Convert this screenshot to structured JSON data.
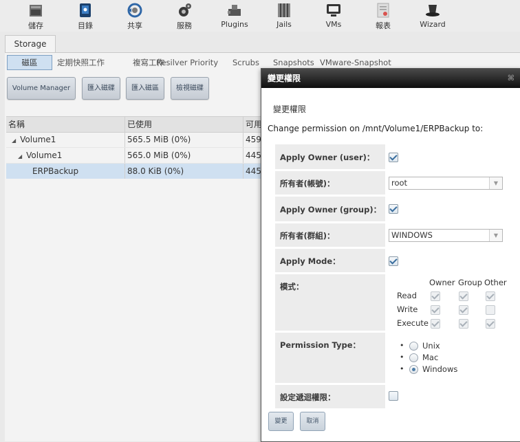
{
  "toolbar": [
    {
      "label": "儲存",
      "icon": "storage-icon"
    },
    {
      "label": "目錄",
      "icon": "directory-icon"
    },
    {
      "label": "共享",
      "icon": "sharing-icon"
    },
    {
      "label": "服務",
      "icon": "services-icon"
    },
    {
      "label": "Plugins",
      "icon": "plugins-icon"
    },
    {
      "label": "Jails",
      "icon": "jails-icon"
    },
    {
      "label": "VMs",
      "icon": "vms-icon"
    },
    {
      "label": "報表",
      "icon": "reporting-icon"
    },
    {
      "label": "Wizard",
      "icon": "wizard-icon"
    }
  ],
  "main": {
    "tab": "Storage",
    "subtabs": [
      "磁區",
      "定期快照工作",
      "複寫工作",
      "Resilver Priority",
      "Scrubs",
      "Snapshots",
      "VMware-Snapshot"
    ],
    "actions": [
      "Volume Manager",
      "匯入磁碟",
      "匯入磁區",
      "檢視磁碟"
    ],
    "table": {
      "headers": [
        "名稱",
        "已使用",
        "可用"
      ],
      "rows": [
        {
          "name": "Volume1",
          "used": "565.5 MiB (0%)",
          "avail": "459"
        },
        {
          "name": "Volume1",
          "used": "565.0 MiB (0%)",
          "avail": "445"
        },
        {
          "name": "ERPBackup",
          "used": "88.0 KiB (0%)",
          "avail": "445"
        }
      ]
    }
  },
  "dialog": {
    "title": "變更權限",
    "close": "⌘",
    "subtitle": "變更權限",
    "description": "Change permission on /mnt/Volume1/ERPBackup to:",
    "apply_owner_user": {
      "label": "Apply Owner (user)：",
      "checked": true
    },
    "owner_user": {
      "label": "所有者(帳號)：",
      "value": "root"
    },
    "apply_owner_group": {
      "label": "Apply Owner (group)：",
      "checked": true
    },
    "owner_group": {
      "label": "所有者(群組)：",
      "value": "WINDOWS"
    },
    "apply_mode": {
      "label": "Apply Mode：",
      "checked": true
    },
    "mode": {
      "label": "模式：",
      "columns": [
        "Owner",
        "Group",
        "Other"
      ],
      "rows": [
        {
          "label": "Read",
          "values": [
            true,
            true,
            true
          ]
        },
        {
          "label": "Write",
          "values": [
            true,
            true,
            false
          ]
        },
        {
          "label": "Execute",
          "values": [
            true,
            true,
            true
          ]
        }
      ]
    },
    "permission_type": {
      "label": "Permission Type：",
      "options": [
        "Unix",
        "Mac",
        "Windows"
      ],
      "selected": "Windows"
    },
    "recursive": {
      "label": "設定遞迴權限：",
      "checked": false
    },
    "buttons": {
      "ok": "變更",
      "cancel": "取消"
    }
  },
  "colors": {
    "selection": "#cfe0f1",
    "titlebar": "#1a1a1a",
    "accent": "#4f7ea8"
  }
}
